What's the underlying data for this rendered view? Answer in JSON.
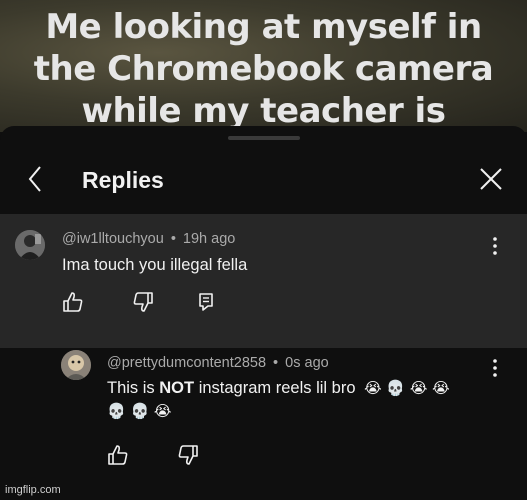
{
  "video": {
    "caption_lines": [
      "Me looking at myself in",
      "the Chromebook camera",
      "while my teacher is"
    ]
  },
  "header": {
    "title": "Replies"
  },
  "parent_comment": {
    "author": "@iw1lltouchyou",
    "separator": "•",
    "time": "19h ago",
    "text": "Ima touch you illegal fella"
  },
  "reply_comment": {
    "author": "@prettydumcontent2858",
    "separator": "•",
    "time": "0s ago",
    "text_before": "This is ",
    "text_bold": "NOT",
    "text_after": " instagram reels lil bro",
    "emoji_line1": "😭 💀 😭 😭",
    "emoji_line2": "💀 💀 😭"
  },
  "watermark": "imgflip.com",
  "colors": {
    "background": "#0f0f0f",
    "parent_highlight": "#272727",
    "meta_text": "#aaaaaa",
    "primary_text": "#f1f1f1"
  },
  "icons": {
    "back": "chevron-left-icon",
    "close": "close-icon",
    "like": "thumbs-up-icon",
    "dislike": "thumbs-down-icon",
    "reply": "comment-icon",
    "more": "more-vertical-icon"
  }
}
